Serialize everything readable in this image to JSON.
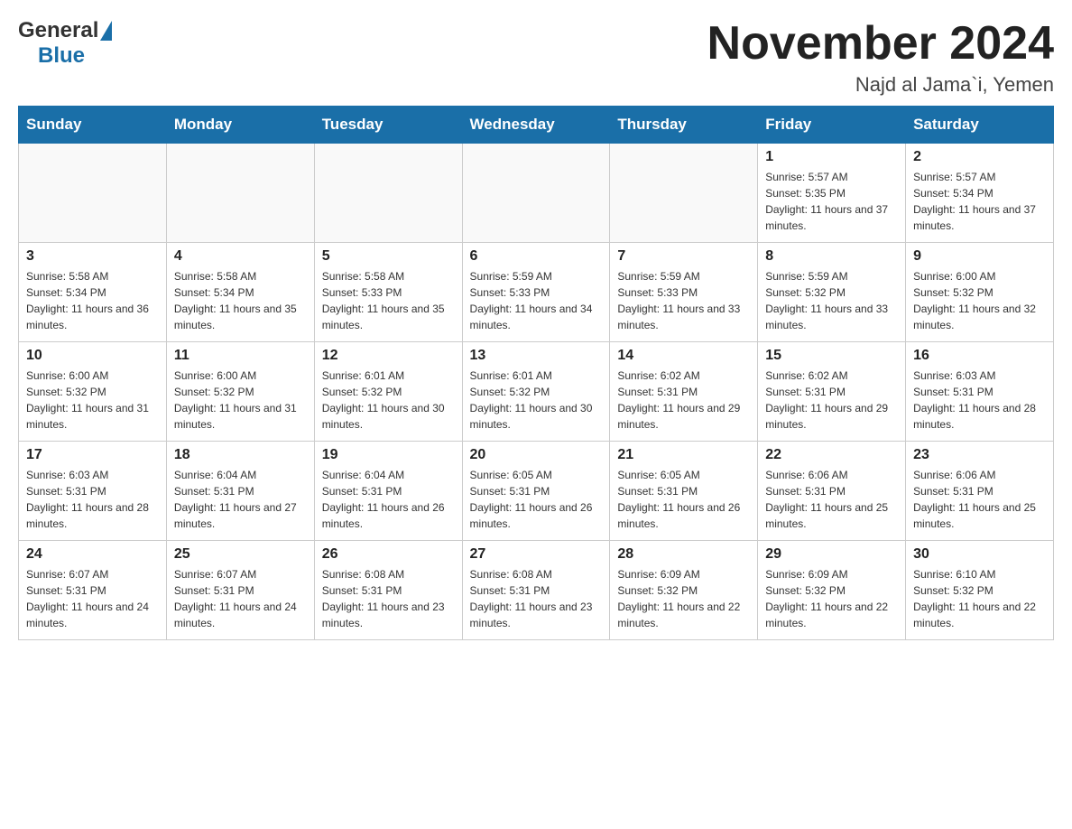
{
  "header": {
    "title": "November 2024",
    "location": "Najd al Jama`i, Yemen",
    "logo": {
      "general": "General",
      "blue": "Blue"
    }
  },
  "weekdays": [
    "Sunday",
    "Monday",
    "Tuesday",
    "Wednesday",
    "Thursday",
    "Friday",
    "Saturday"
  ],
  "weeks": [
    [
      {
        "day": "",
        "sunrise": "",
        "sunset": "",
        "daylight": ""
      },
      {
        "day": "",
        "sunrise": "",
        "sunset": "",
        "daylight": ""
      },
      {
        "day": "",
        "sunrise": "",
        "sunset": "",
        "daylight": ""
      },
      {
        "day": "",
        "sunrise": "",
        "sunset": "",
        "daylight": ""
      },
      {
        "day": "",
        "sunrise": "",
        "sunset": "",
        "daylight": ""
      },
      {
        "day": "1",
        "sunrise": "Sunrise: 5:57 AM",
        "sunset": "Sunset: 5:35 PM",
        "daylight": "Daylight: 11 hours and 37 minutes."
      },
      {
        "day": "2",
        "sunrise": "Sunrise: 5:57 AM",
        "sunset": "Sunset: 5:34 PM",
        "daylight": "Daylight: 11 hours and 37 minutes."
      }
    ],
    [
      {
        "day": "3",
        "sunrise": "Sunrise: 5:58 AM",
        "sunset": "Sunset: 5:34 PM",
        "daylight": "Daylight: 11 hours and 36 minutes."
      },
      {
        "day": "4",
        "sunrise": "Sunrise: 5:58 AM",
        "sunset": "Sunset: 5:34 PM",
        "daylight": "Daylight: 11 hours and 35 minutes."
      },
      {
        "day": "5",
        "sunrise": "Sunrise: 5:58 AM",
        "sunset": "Sunset: 5:33 PM",
        "daylight": "Daylight: 11 hours and 35 minutes."
      },
      {
        "day": "6",
        "sunrise": "Sunrise: 5:59 AM",
        "sunset": "Sunset: 5:33 PM",
        "daylight": "Daylight: 11 hours and 34 minutes."
      },
      {
        "day": "7",
        "sunrise": "Sunrise: 5:59 AM",
        "sunset": "Sunset: 5:33 PM",
        "daylight": "Daylight: 11 hours and 33 minutes."
      },
      {
        "day": "8",
        "sunrise": "Sunrise: 5:59 AM",
        "sunset": "Sunset: 5:32 PM",
        "daylight": "Daylight: 11 hours and 33 minutes."
      },
      {
        "day": "9",
        "sunrise": "Sunrise: 6:00 AM",
        "sunset": "Sunset: 5:32 PM",
        "daylight": "Daylight: 11 hours and 32 minutes."
      }
    ],
    [
      {
        "day": "10",
        "sunrise": "Sunrise: 6:00 AM",
        "sunset": "Sunset: 5:32 PM",
        "daylight": "Daylight: 11 hours and 31 minutes."
      },
      {
        "day": "11",
        "sunrise": "Sunrise: 6:00 AM",
        "sunset": "Sunset: 5:32 PM",
        "daylight": "Daylight: 11 hours and 31 minutes."
      },
      {
        "day": "12",
        "sunrise": "Sunrise: 6:01 AM",
        "sunset": "Sunset: 5:32 PM",
        "daylight": "Daylight: 11 hours and 30 minutes."
      },
      {
        "day": "13",
        "sunrise": "Sunrise: 6:01 AM",
        "sunset": "Sunset: 5:32 PM",
        "daylight": "Daylight: 11 hours and 30 minutes."
      },
      {
        "day": "14",
        "sunrise": "Sunrise: 6:02 AM",
        "sunset": "Sunset: 5:31 PM",
        "daylight": "Daylight: 11 hours and 29 minutes."
      },
      {
        "day": "15",
        "sunrise": "Sunrise: 6:02 AM",
        "sunset": "Sunset: 5:31 PM",
        "daylight": "Daylight: 11 hours and 29 minutes."
      },
      {
        "day": "16",
        "sunrise": "Sunrise: 6:03 AM",
        "sunset": "Sunset: 5:31 PM",
        "daylight": "Daylight: 11 hours and 28 minutes."
      }
    ],
    [
      {
        "day": "17",
        "sunrise": "Sunrise: 6:03 AM",
        "sunset": "Sunset: 5:31 PM",
        "daylight": "Daylight: 11 hours and 28 minutes."
      },
      {
        "day": "18",
        "sunrise": "Sunrise: 6:04 AM",
        "sunset": "Sunset: 5:31 PM",
        "daylight": "Daylight: 11 hours and 27 minutes."
      },
      {
        "day": "19",
        "sunrise": "Sunrise: 6:04 AM",
        "sunset": "Sunset: 5:31 PM",
        "daylight": "Daylight: 11 hours and 26 minutes."
      },
      {
        "day": "20",
        "sunrise": "Sunrise: 6:05 AM",
        "sunset": "Sunset: 5:31 PM",
        "daylight": "Daylight: 11 hours and 26 minutes."
      },
      {
        "day": "21",
        "sunrise": "Sunrise: 6:05 AM",
        "sunset": "Sunset: 5:31 PM",
        "daylight": "Daylight: 11 hours and 26 minutes."
      },
      {
        "day": "22",
        "sunrise": "Sunrise: 6:06 AM",
        "sunset": "Sunset: 5:31 PM",
        "daylight": "Daylight: 11 hours and 25 minutes."
      },
      {
        "day": "23",
        "sunrise": "Sunrise: 6:06 AM",
        "sunset": "Sunset: 5:31 PM",
        "daylight": "Daylight: 11 hours and 25 minutes."
      }
    ],
    [
      {
        "day": "24",
        "sunrise": "Sunrise: 6:07 AM",
        "sunset": "Sunset: 5:31 PM",
        "daylight": "Daylight: 11 hours and 24 minutes."
      },
      {
        "day": "25",
        "sunrise": "Sunrise: 6:07 AM",
        "sunset": "Sunset: 5:31 PM",
        "daylight": "Daylight: 11 hours and 24 minutes."
      },
      {
        "day": "26",
        "sunrise": "Sunrise: 6:08 AM",
        "sunset": "Sunset: 5:31 PM",
        "daylight": "Daylight: 11 hours and 23 minutes."
      },
      {
        "day": "27",
        "sunrise": "Sunrise: 6:08 AM",
        "sunset": "Sunset: 5:31 PM",
        "daylight": "Daylight: 11 hours and 23 minutes."
      },
      {
        "day": "28",
        "sunrise": "Sunrise: 6:09 AM",
        "sunset": "Sunset: 5:32 PM",
        "daylight": "Daylight: 11 hours and 22 minutes."
      },
      {
        "day": "29",
        "sunrise": "Sunrise: 6:09 AM",
        "sunset": "Sunset: 5:32 PM",
        "daylight": "Daylight: 11 hours and 22 minutes."
      },
      {
        "day": "30",
        "sunrise": "Sunrise: 6:10 AM",
        "sunset": "Sunset: 5:32 PM",
        "daylight": "Daylight: 11 hours and 22 minutes."
      }
    ]
  ]
}
